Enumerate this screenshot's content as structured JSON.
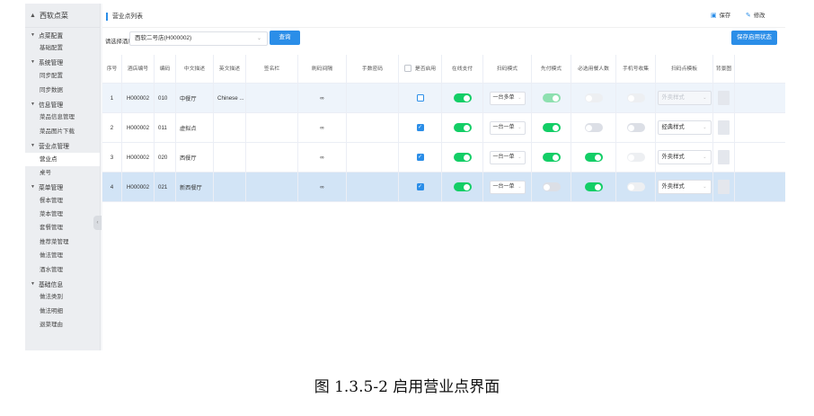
{
  "sidebar": {
    "brand": "西软点菜",
    "groups": [
      {
        "label": "点菜配置",
        "items": [
          "基础配置"
        ]
      },
      {
        "label": "系统管理",
        "items": [
          "同步配置",
          "同步数据"
        ]
      },
      {
        "label": "信息管理",
        "items": [
          "菜品信息管理",
          "菜品图片下载"
        ]
      },
      {
        "label": "营业点管理",
        "items": [
          "营业点",
          "桌号"
        ]
      },
      {
        "label": "菜单管理",
        "items": [
          "餐本管理",
          "菜本管理",
          "套餐管理",
          "推荐菜管理",
          "做法管理",
          "酒水管理"
        ]
      },
      {
        "label": "基础信息",
        "items": [
          "做法类别",
          "做法明细",
          "退菜理由"
        ]
      }
    ]
  },
  "main": {
    "title": "营业点列表",
    "actions": {
      "save": "保存",
      "edit": "修改"
    },
    "filter": {
      "label": "请选择酒店",
      "hotel": "西软二号店(H000002)",
      "query_button": "查询",
      "save_status_button": "保存启用状态"
    },
    "table": {
      "columns": [
        "序号",
        "酒店编号",
        "编码",
        "中文描述",
        "英文描述",
        "签名栏",
        "刷码间隔",
        "手数密码",
        "是否启用",
        "在线支付",
        "扫码模式",
        "先付模式",
        "必选用餐人数",
        "手机号收集",
        "扫码点模板",
        "背景图"
      ],
      "rows": [
        {
          "index": "1",
          "hotel_no": "H000002",
          "code": "010",
          "name_cn": "中餐厅",
          "name_en": "Chinese ...",
          "interval": "∞",
          "enabled": false,
          "online_pay": true,
          "scan_mode": "一台多单",
          "prepay": "light-on",
          "must_people": "light-off",
          "phone_collect": "light-off",
          "template": "外卖样式",
          "template_disabled": true
        },
        {
          "index": "2",
          "hotel_no": "H000002",
          "code": "011",
          "name_cn": "虚拟点",
          "name_en": "",
          "interval": "∞",
          "enabled": true,
          "online_pay": true,
          "scan_mode": "一台一单",
          "prepay": "on",
          "must_people": "off",
          "phone_collect": "off",
          "template": "经典样式",
          "template_disabled": false
        },
        {
          "index": "3",
          "hotel_no": "H000002",
          "code": "020",
          "name_cn": "西餐厅",
          "name_en": "",
          "interval": "∞",
          "enabled": true,
          "online_pay": true,
          "scan_mode": "一台一单",
          "prepay": "on",
          "must_people": "on",
          "phone_collect": "light-off",
          "template": "外卖样式",
          "template_disabled": false
        },
        {
          "index": "4",
          "hotel_no": "H000002",
          "code": "021",
          "name_cn": "新西餐厅",
          "name_en": "",
          "interval": "∞",
          "enabled": true,
          "online_pay": true,
          "scan_mode": "一台一单",
          "prepay": "off",
          "must_people": "on",
          "phone_collect": "light-off",
          "template": "外卖样式",
          "template_disabled": false
        }
      ]
    }
  },
  "caption": "图 1.3.5-2  启用营业点界面",
  "colors": {
    "accent": "#2b8ee8",
    "switch_on": "#13ce66",
    "selected_row": "#d2e4f6"
  }
}
